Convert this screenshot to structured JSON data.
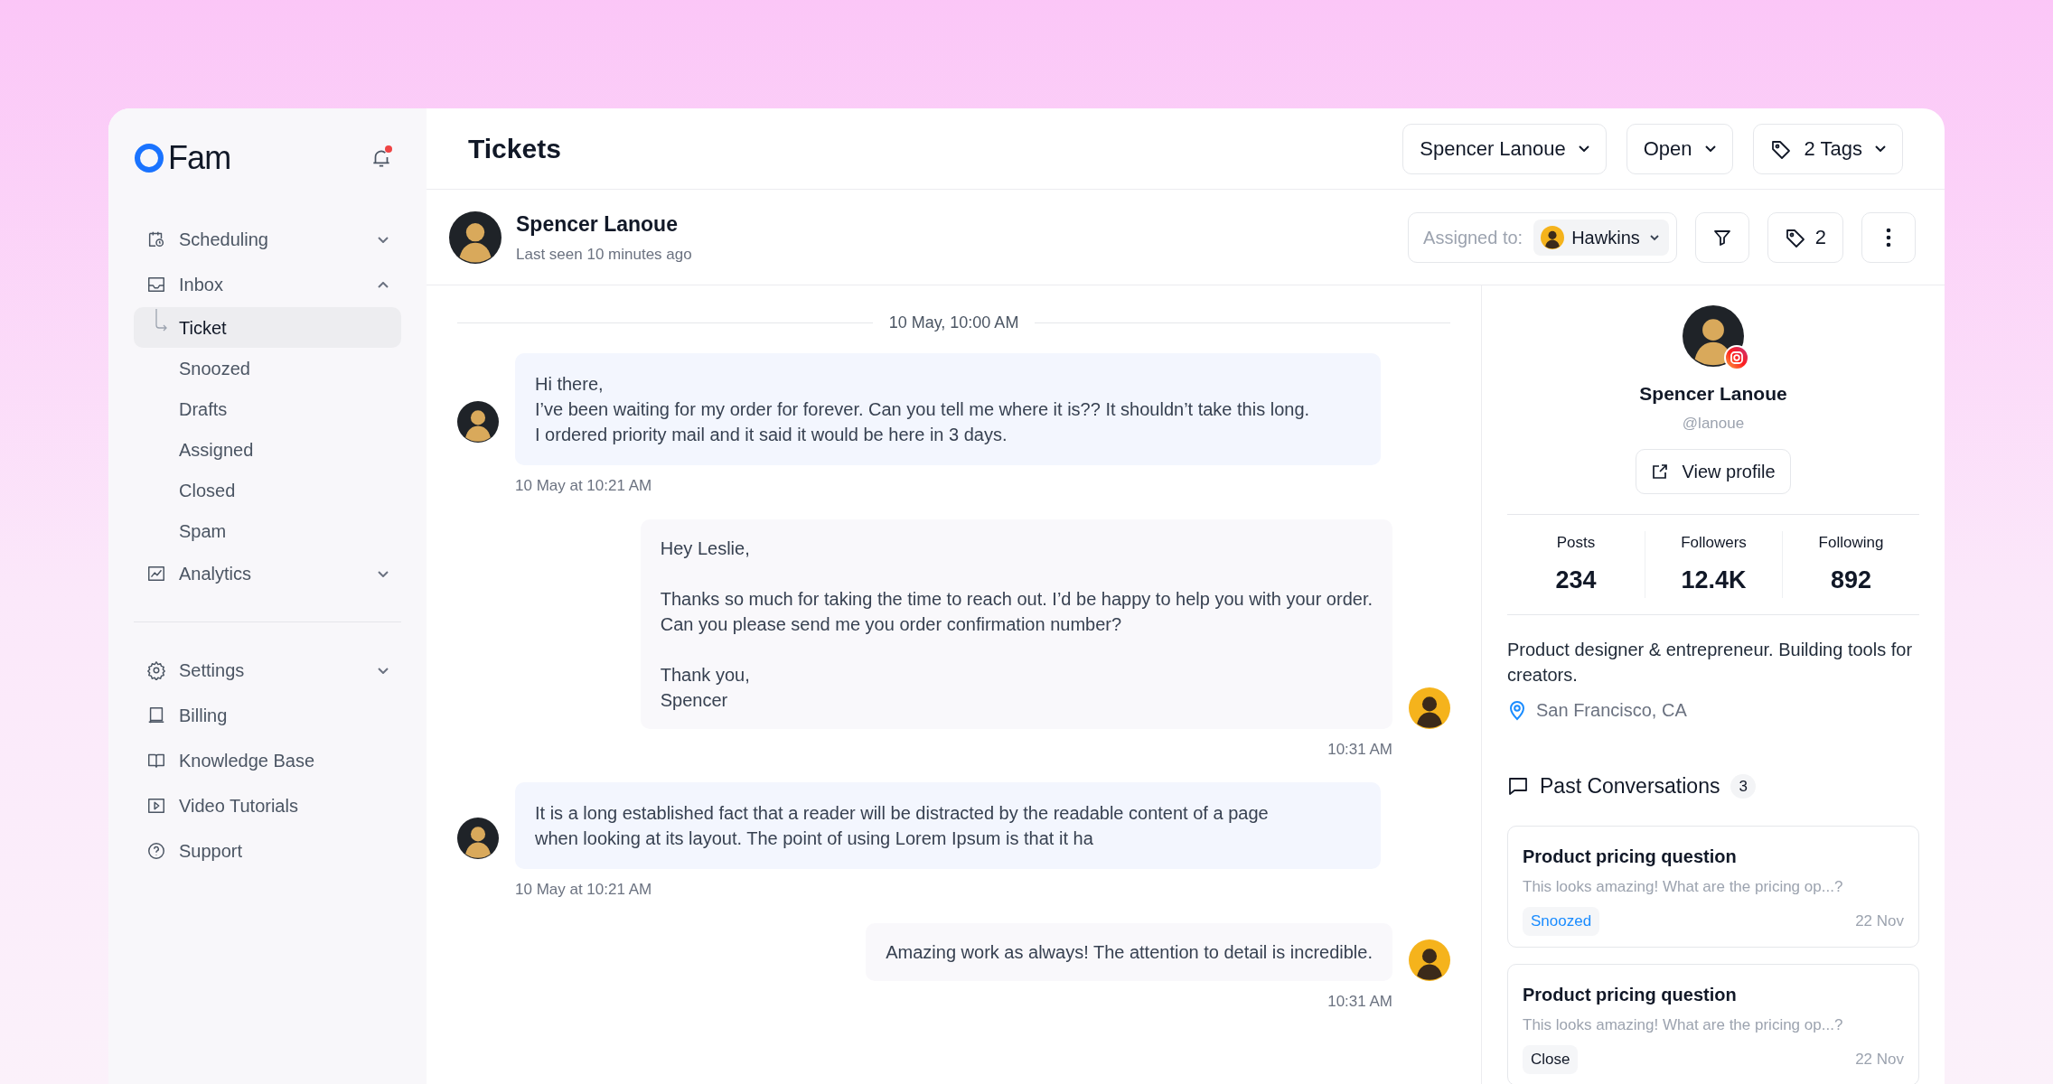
{
  "brand": {
    "name": "Fam"
  },
  "notifications": {
    "unread": true
  },
  "sidebar": {
    "items": [
      {
        "label": "Scheduling",
        "expanded": false,
        "selected": false
      },
      {
        "label": "Inbox",
        "expanded": true,
        "selected": false,
        "children": [
          {
            "label": "Ticket",
            "selected": true
          },
          {
            "label": "Snoozed",
            "selected": false
          },
          {
            "label": "Drafts",
            "selected": false
          },
          {
            "label": "Assigned",
            "selected": false
          },
          {
            "label": "Closed",
            "selected": false
          },
          {
            "label": "Spam",
            "selected": false
          }
        ]
      },
      {
        "label": "Analytics",
        "expanded": false,
        "selected": false
      }
    ],
    "footer_items": [
      {
        "label": "Settings",
        "expanded": false,
        "selected": false
      },
      {
        "label": "Billing",
        "selected": false
      },
      {
        "label": "Knowledge Base",
        "selected": false
      },
      {
        "label": "Video Tutorials",
        "selected": false
      },
      {
        "label": "Support",
        "selected": false
      }
    ]
  },
  "header": {
    "title": "Tickets",
    "filters": [
      "Spencer Lanoue",
      "Open",
      "2 Tags"
    ]
  },
  "contact_bar": {
    "name": "Spencer Lanoue",
    "last_seen": "Last seen 10 minutes ago",
    "assigned_label": "Assigned to:",
    "assignee": "Hawkins",
    "tag_count": "2"
  },
  "chat": {
    "date_separator": "10 May, 10:00 AM",
    "messages": [
      {
        "kind": "incoming",
        "text": "Hi there,\nI’ve been waiting for my order for forever. Can you tell me where it is?? It shouldn’t take this long.\nI ordered priority mail and it said it would be here in 3 days.",
        "time": "10 May at 10:21 AM"
      },
      {
        "kind": "outgoing",
        "text": "Hey Leslie,\n\nThanks so much for taking the time to reach out. I’d be happy to help you with your order.\nCan you please send me you order confirmation number?\n\nThank you,\nSpencer",
        "time": "10:31 AM"
      },
      {
        "kind": "incoming",
        "text": "It is a long established fact that a reader will be distracted by the readable content of a page\nwhen looking at its layout. The point of using Lorem Ipsum is that it ha",
        "time": "10 May at 10:21 AM"
      },
      {
        "kind": "outgoing",
        "text": "Amazing work as always! The attention to detail is incredible.",
        "time": "10:31 AM"
      }
    ]
  },
  "profile": {
    "name": "Spencer Lanoue",
    "handle": "@lanoue",
    "view_button": "View profile",
    "stats": [
      {
        "label": "Posts",
        "value": "234"
      },
      {
        "label": "Followers",
        "value": "12.4K"
      },
      {
        "label": "Following",
        "value": "892"
      }
    ],
    "bio": "Product designer & entrepreneur. Building tools for creators.",
    "location": "San Francisco, CA"
  },
  "past_conversations": {
    "title": "Past Conversations",
    "count": "3",
    "items": [
      {
        "title": "Product pricing question",
        "preview": "This looks amazing! What are the pricing op...?",
        "status": "Snoozed",
        "color": "#1a8cff",
        "date": "22 Nov"
      },
      {
        "title": "Product pricing question",
        "preview": "This looks amazing! What are the pricing op...?",
        "status": "Close",
        "color": "#111827",
        "date": "22 Nov"
      }
    ]
  }
}
